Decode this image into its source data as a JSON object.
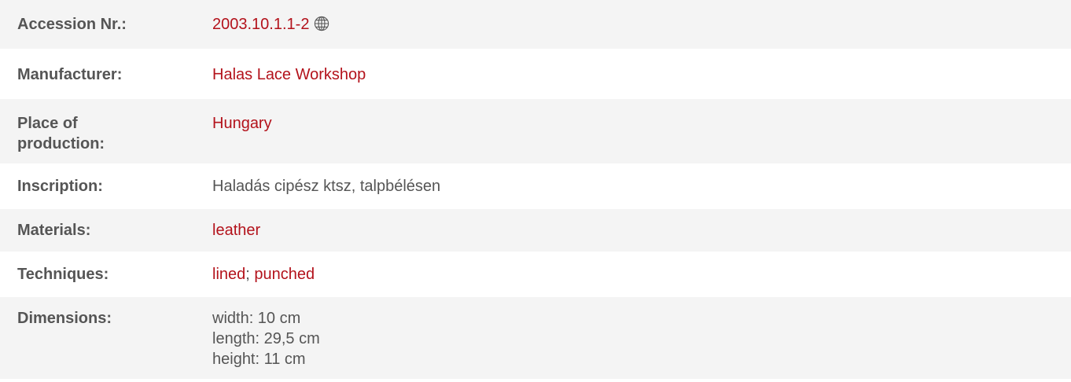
{
  "rows": {
    "accession": {
      "label": "Accession Nr.:",
      "value": "2003.10.1.1-2",
      "icon": "globe-icon"
    },
    "manufacturer": {
      "label": "Manufacturer:",
      "value": "Halas Lace Workshop"
    },
    "place": {
      "label_line1": "Place of",
      "label_line2": "production:",
      "value": "Hungary"
    },
    "inscription": {
      "label": "Inscription:",
      "value": "Haladás cipész ktsz, talpbélésen"
    },
    "materials": {
      "label": "Materials:",
      "value": "leather"
    },
    "techniques": {
      "label": "Techniques:",
      "values": [
        "lined",
        "punched"
      ],
      "separator": ";"
    },
    "dimensions": {
      "label": "Dimensions:",
      "lines": [
        "width: 10 cm",
        "length: 29,5 cm",
        "height: 11 cm"
      ]
    }
  },
  "colors": {
    "link": "#b3121b",
    "text": "#555555",
    "row_alt_bg": "#f4f4f4"
  }
}
